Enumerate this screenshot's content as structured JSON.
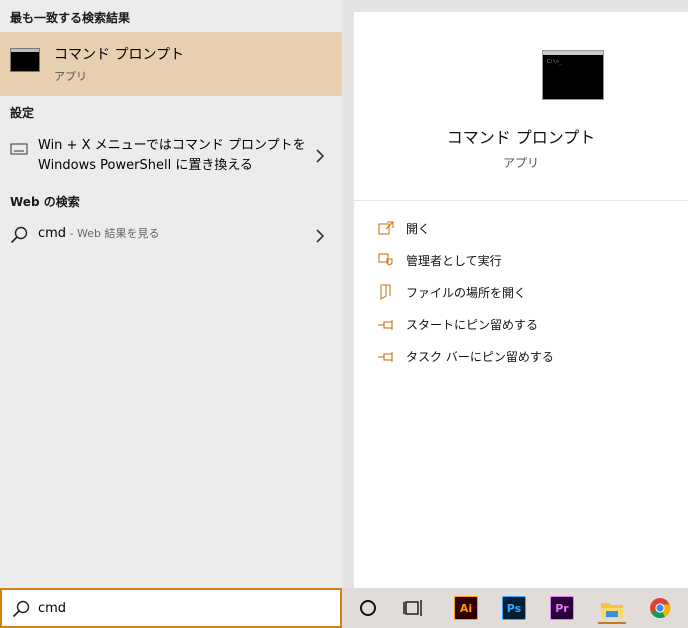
{
  "left": {
    "best_match_title": "最も一致する検索結果",
    "best_match": {
      "name": "コマンド プロンプト",
      "type": "アプリ"
    },
    "settings_title": "設定",
    "settings_item": {
      "line1": "Win + X メニューではコマンド プロンプトを",
      "line2": "Windows PowerShell に置き換える"
    },
    "web_title": "Web の検索",
    "web_item": {
      "query": "cmd",
      "suffix": " - Web 結果を見る"
    }
  },
  "search": {
    "value": "cmd"
  },
  "preview": {
    "title": "コマンド プロンプト",
    "subtitle": "アプリ",
    "actions": [
      {
        "label": "開く",
        "icon": "open-icon"
      },
      {
        "label": "管理者として実行",
        "icon": "shield-icon"
      },
      {
        "label": "ファイルの場所を開く",
        "icon": "file-location-icon"
      },
      {
        "label": "スタートにピン留めする",
        "icon": "pin-icon"
      },
      {
        "label": "タスク バーにピン留めする",
        "icon": "pin-icon"
      }
    ]
  },
  "taskbar": {
    "apps": [
      {
        "name": "cortana-icon"
      },
      {
        "name": "task-view-icon"
      },
      {
        "name": "illustrator-icon",
        "text": "Ai",
        "bg": "#300000",
        "fg": "#ff9a00"
      },
      {
        "name": "photoshop-icon",
        "text": "Ps",
        "bg": "#001e36",
        "fg": "#31a8ff"
      },
      {
        "name": "premiere-icon",
        "text": "Pr",
        "bg": "#2a0038",
        "fg": "#ea77ff"
      },
      {
        "name": "file-explorer-icon"
      },
      {
        "name": "chrome-icon"
      }
    ]
  },
  "colors": {
    "accent": "#d47f1a",
    "highlight": "#e8cfb0"
  }
}
